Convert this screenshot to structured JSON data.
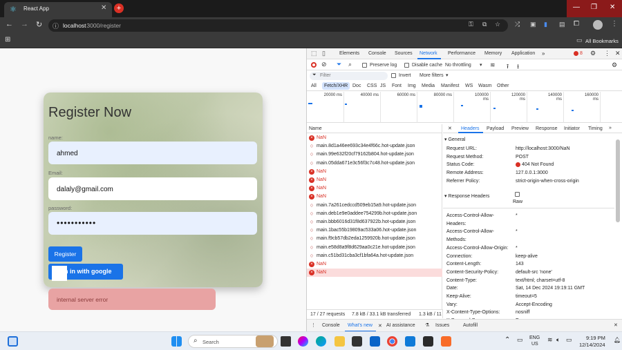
{
  "browser": {
    "tab_title": "React App",
    "url_host": "localhost",
    "url_path": ":3000/register",
    "bookmarks_label": "All Bookmarks"
  },
  "form": {
    "title": "Register Now",
    "name_label": "name:",
    "name_value": "ahmed",
    "email_label": "Email:",
    "email_value": "dalaly@gmail.com",
    "password_label": "password:",
    "password_value": "•••••••••••",
    "register_label": "Register",
    "google_label": "n in with google",
    "error_text": "internal server error"
  },
  "devtools": {
    "tabs": [
      "Elements",
      "Console",
      "Sources",
      "Network",
      "Performance",
      "Memory",
      "Application"
    ],
    "issues_count": "8",
    "toolbar": {
      "preserve_log": "Preserve log",
      "disable_cache": "Disable cache",
      "throttling": "No throttling"
    },
    "filter": {
      "placeholder": "Filter",
      "invert": "Invert",
      "more_filters": "More filters"
    },
    "type_filters": [
      "All",
      "Fetch/XHR",
      "Doc",
      "CSS",
      "JS",
      "Font",
      "Img",
      "Media",
      "Manifest",
      "WS",
      "Wasm",
      "Other"
    ],
    "timeline_ticks": [
      "20000 ms",
      "40000 ms",
      "60000 ms",
      "80000 ms",
      "100000 ms",
      "120000 ms",
      "140000 ms",
      "160000 ms"
    ],
    "name_header": "Name",
    "requests": [
      {
        "name": "NaN",
        "error": true
      },
      {
        "name": "main.8d1a46ee693c34e4f66c.hot-update.json",
        "error": false
      },
      {
        "name": "main.99e632f20cf79162b804.hot-update.json",
        "error": false
      },
      {
        "name": "main.05dda671e3c56f3c7c48.hot-update.json",
        "error": false
      },
      {
        "name": "NaN",
        "error": true
      },
      {
        "name": "NaN",
        "error": true
      },
      {
        "name": "NaN",
        "error": true
      },
      {
        "name": "NaN",
        "error": true
      },
      {
        "name": "main.7a261cedccd509eb15a9.hot-update.json",
        "error": false
      },
      {
        "name": "main.deb1e9e0addee754299b.hot-update.json",
        "error": false
      },
      {
        "name": "main.bbb6016d31f8d637922b.hot-update.json",
        "error": false
      },
      {
        "name": "main.1bac55b19809ac533a06.hot-update.json",
        "error": false
      },
      {
        "name": "main.f9cb57db2eda1259920b.hot-update.json",
        "error": false
      },
      {
        "name": "main.e58d8a9f8d629aa0c21e.hot-update.json",
        "error": false
      },
      {
        "name": "main.c51bd31cba3cf1bfa64a.hot-update.json",
        "error": false
      },
      {
        "name": "NaN",
        "error": true
      },
      {
        "name": "NaN",
        "error": true
      }
    ],
    "status_bar": {
      "requests": "17 / 27 requests",
      "transferred": "7.8 kB / 33.1 kB transferred",
      "resources": "1.3 kB / 11"
    },
    "detail_tabs": [
      "Headers",
      "Payload",
      "Preview",
      "Response",
      "Initiator",
      "Timing"
    ],
    "general_title": "General",
    "general": [
      [
        "Request URL:",
        "http://localhost:3000/NaN"
      ],
      [
        "Request Method:",
        "POST"
      ],
      [
        "Status Code:",
        "404 Not Found"
      ],
      [
        "Remote Address:",
        "127.0.0.1:3000"
      ],
      [
        "Referrer Policy:",
        "strict-origin-when-cross-origin"
      ]
    ],
    "response_title": "Response Headers",
    "raw_label": "Raw",
    "response": [
      [
        "Access-Control-Allow-",
        "*"
      ],
      [
        "Headers:",
        ""
      ],
      [
        "Access-Control-Allow-",
        "*"
      ],
      [
        "Methods:",
        ""
      ],
      [
        "Access-Control-Allow-Origin:",
        "*"
      ],
      [
        "Connection:",
        "keep-alive"
      ],
      [
        "Content-Length:",
        "143"
      ],
      [
        "Content-Security-Policy:",
        "default-src 'none'"
      ],
      [
        "Content-Type:",
        "text/html; charset=utf-8"
      ],
      [
        "Date:",
        "Sat, 14 Dec 2024 19:19:11 GMT"
      ],
      [
        "Keep-Alive:",
        "timeout=5"
      ],
      [
        "Vary:",
        "Accept-Encoding"
      ],
      [
        "X-Content-Type-Options:",
        "nosniff"
      ],
      [
        "X-Powered-By:",
        "Express"
      ]
    ],
    "drawer_tabs": [
      "Console",
      "What's new",
      "AI assistance",
      "Issues",
      "Autofill"
    ]
  },
  "taskbar": {
    "search": "Search",
    "lang": "ENG",
    "region": "US",
    "time": "9:19 PM",
    "date": "12/14/2024"
  },
  "colors": {
    "accent": "#1a73e8",
    "error": "#d93025",
    "error_bg": "#e8a3a3"
  }
}
